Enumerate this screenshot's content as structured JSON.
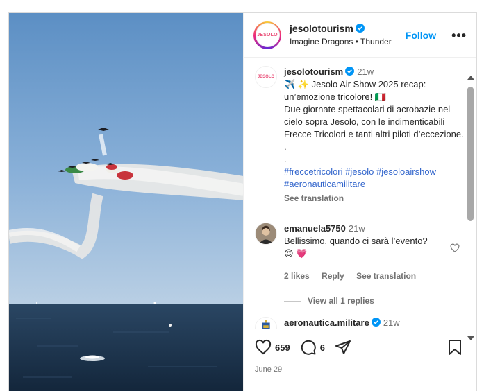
{
  "post": {
    "username": "jesolotourism",
    "logo_text": "JESOLO",
    "audio": "Imagine Dragons • Thunder",
    "follow_label": "Follow",
    "more_label": "•••"
  },
  "caption": {
    "username": "jesolotourism",
    "time": "21w",
    "line1": "✈️ ✨ Jesolo Air Show 2025 recap: un’emozione tricolore! 🇮🇹",
    "line2": "Due giornate spettacolari di acrobazie nel cielo sopra Jesolo, con le indimenticabili Frecce Tricolori e tanti altri piloti d’eccezione.",
    "dot1": ".",
    "dot2": ".",
    "hashtags": [
      "#freccetricolori",
      "#jesolo",
      "#jesoloairshow",
      "#aeronauticamilitare"
    ],
    "see_translation": "See translation"
  },
  "comments": [
    {
      "username": "emanuela5750",
      "time": "21w",
      "text": "Bellissimo, quando ci sarà l’evento?",
      "emoji": "😍 💗",
      "likes": "2 likes",
      "reply": "Reply",
      "see_translation": "See translation",
      "view_replies": "View all 1 replies"
    },
    {
      "username": "aeronautica.militare",
      "time": "21w"
    }
  ],
  "actions": {
    "likes": "659",
    "comments": "6",
    "date": "June 29"
  },
  "colors": {
    "accent": "#0095f6",
    "hashtag": "#3366cc",
    "sky": "#7fa6cf",
    "sea": "#1f3a57"
  }
}
